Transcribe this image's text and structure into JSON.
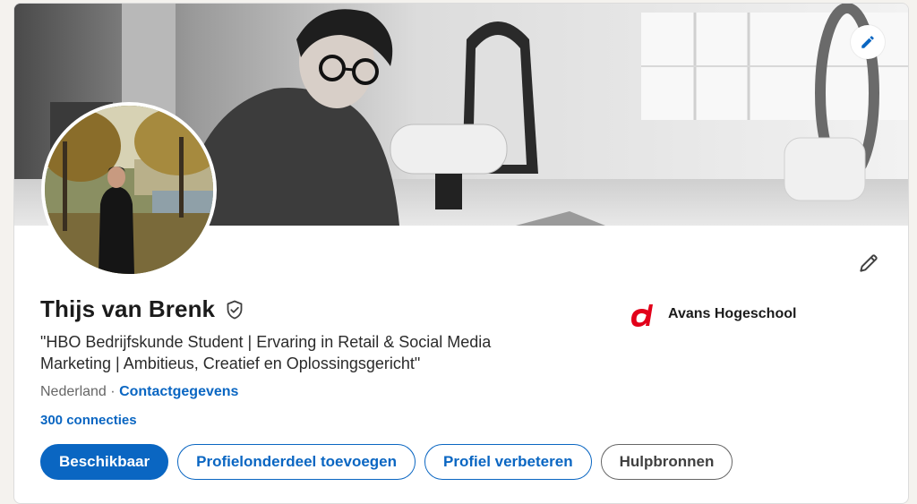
{
  "profile": {
    "name": "Thijs van Brenk",
    "headline": "\"HBO Bedrijfskunde Student | Ervaring in Retail & Social Media Marketing | Ambitieus, Creatief en Oplossingsgericht\"",
    "location": "Nederland",
    "separator": "·",
    "contact_link": "Contactgegevens",
    "connections": "300 connecties"
  },
  "education": {
    "school": "Avans Hogeschool",
    "logo_icon": "avans-logo-icon",
    "logo_color": "#e2001a"
  },
  "actions": {
    "available": "Beschikbaar",
    "add_section": "Profielonderdeel toevoegen",
    "improve_profile": "Profiel verbeteren",
    "resources": "Hulpbronnen"
  },
  "icons": {
    "banner_edit": "pencil-icon",
    "intro_edit": "pencil-icon",
    "verification": "shield-check-icon"
  },
  "colors": {
    "accent": "#0a66c2",
    "text": "#1b1b1b",
    "muted": "#666666",
    "background": "#f4f2ee"
  }
}
